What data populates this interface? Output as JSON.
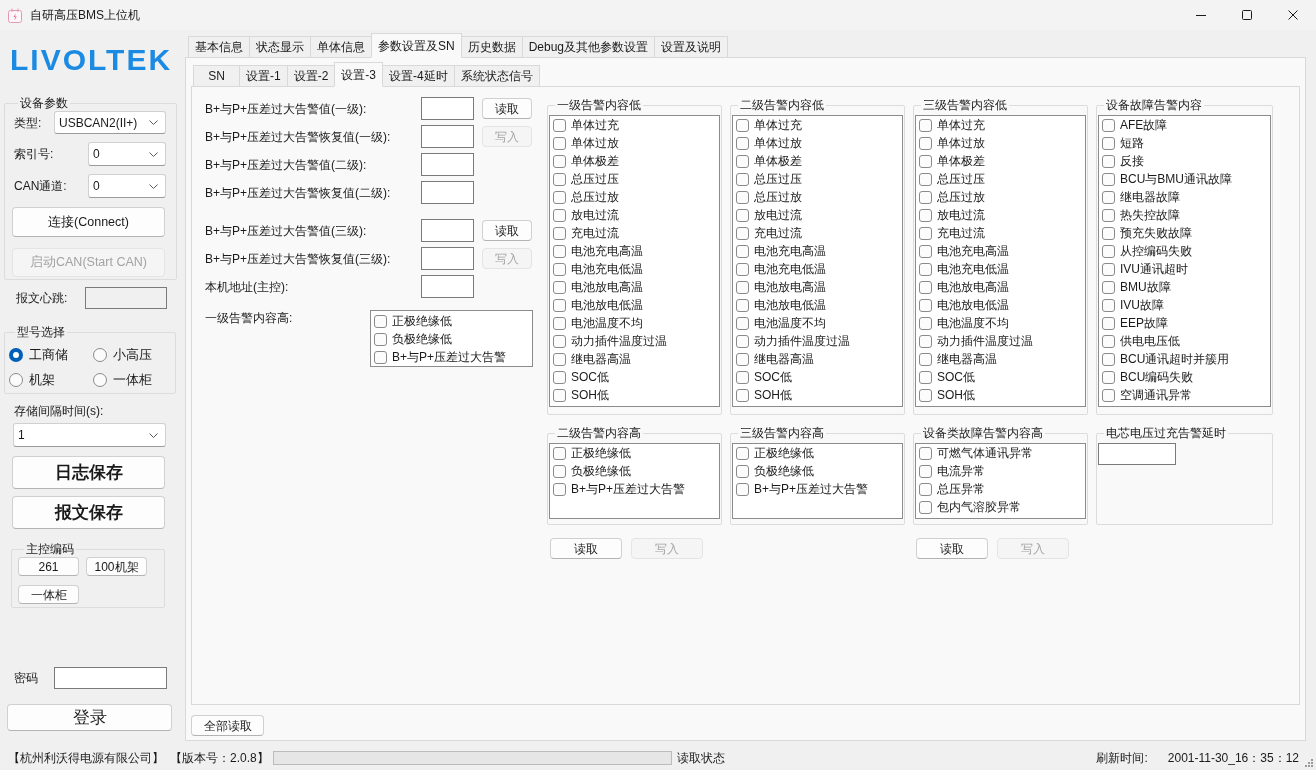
{
  "window": {
    "title": "自研高压BMS上位机"
  },
  "sidebar": {
    "logo": "LIVOLTEK",
    "device_params": {
      "title": "设备参数",
      "selects": [
        {
          "label": "类型:",
          "value": "USBCAN2(II+)"
        },
        {
          "label": "索引号:",
          "value": "0"
        },
        {
          "label": "CAN通道:",
          "value": "0"
        }
      ],
      "buttons": [
        {
          "label": "连接(Connect)",
          "disabled": false
        },
        {
          "label": "启动CAN(Start CAN)",
          "disabled": true
        }
      ]
    },
    "heartbeat": {
      "label": "报文心跳:"
    },
    "model_select": {
      "title": "型号选择",
      "options": [
        {
          "label": "工商储",
          "selected": true
        },
        {
          "label": "小高压",
          "selected": false
        },
        {
          "label": "机架",
          "selected": false
        },
        {
          "label": "一体柜",
          "selected": false
        }
      ]
    },
    "storage_interval": {
      "label": "存储间隔时间(s):",
      "value": "1"
    },
    "save_buttons": [
      "日志保存",
      "报文保存"
    ],
    "master_code": {
      "title": "主控编码",
      "buttons": [
        "261",
        "100机架",
        "一体柜"
      ]
    },
    "password": {
      "label": "密码"
    },
    "login_button": "登录"
  },
  "tabs": [
    {
      "label": "基本信息",
      "selected": false
    },
    {
      "label": "状态显示",
      "selected": false
    },
    {
      "label": "单体信息",
      "selected": false
    },
    {
      "label": "参数设置及SN",
      "selected": true
    },
    {
      "label": "历史数据",
      "selected": false
    },
    {
      "label": "Debug及其他参数设置",
      "selected": false
    },
    {
      "label": "设置及说明",
      "selected": false
    }
  ],
  "sub_tabs": [
    {
      "label": "SN",
      "selected": false
    },
    {
      "label": "设置-1",
      "selected": false
    },
    {
      "label": "设置-2",
      "selected": false
    },
    {
      "label": "设置-3",
      "selected": true
    },
    {
      "label": "设置-4延时",
      "selected": false
    },
    {
      "label": "系统状态信号",
      "selected": false
    }
  ],
  "settings": {
    "field_groups": [
      [
        {
          "label": "B+与P+压差过大告警值(一级):",
          "button": {
            "label": "读取",
            "disabled": false
          }
        },
        {
          "label": "B+与P+压差过大告警恢复值(一级):",
          "button": {
            "label": "写入",
            "disabled": true
          }
        },
        {
          "label": "B+与P+压差过大告警值(二级):"
        },
        {
          "label": "B+与P+压差过大告警恢复值(二级):"
        }
      ],
      [
        {
          "label": "B+与P+压差过大告警值(三级):",
          "button": {
            "label": "读取",
            "disabled": false
          }
        },
        {
          "label": "B+与P+压差过大告警恢复值(三级):",
          "button": {
            "label": "写入",
            "disabled": true
          }
        },
        {
          "label": "本机地址(主控):"
        }
      ]
    ],
    "level1_high": {
      "label": "一级告警内容高:",
      "items": [
        {
          "label": "正极绝缘低",
          "checked": false
        },
        {
          "label": "负极绝缘低",
          "checked": false
        },
        {
          "label": "B+与P+压差过大告警",
          "checked": false
        }
      ]
    },
    "alarm_groups": [
      {
        "kind": "checklist",
        "title": "一级告警内容低",
        "items": [
          {
            "label": "单体过充",
            "checked": false
          },
          {
            "label": "单体过放",
            "checked": false
          },
          {
            "label": "单体极差",
            "checked": false
          },
          {
            "label": "总压过压",
            "checked": false
          },
          {
            "label": "总压过放",
            "checked": false
          },
          {
            "label": "放电过流",
            "checked": false
          },
          {
            "label": "充电过流",
            "checked": false
          },
          {
            "label": "电池充电高温",
            "checked": false
          },
          {
            "label": "电池充电低温",
            "checked": false
          },
          {
            "label": "电池放电高温",
            "checked": false
          },
          {
            "label": "电池放电低温",
            "checked": false
          },
          {
            "label": "电池温度不均",
            "checked": false
          },
          {
            "label": "动力插件温度过温",
            "checked": false
          },
          {
            "label": "继电器高温",
            "checked": false
          },
          {
            "label": "SOC低",
            "checked": false
          },
          {
            "label": "SOH低",
            "checked": false
          }
        ]
      },
      {
        "kind": "checklist",
        "title": "二级告警内容低",
        "items": [
          {
            "label": "单体过充",
            "checked": false
          },
          {
            "label": "单体过放",
            "checked": false
          },
          {
            "label": "单体极差",
            "checked": false
          },
          {
            "label": "总压过压",
            "checked": false
          },
          {
            "label": "总压过放",
            "checked": false
          },
          {
            "label": "放电过流",
            "checked": false
          },
          {
            "label": "充电过流",
            "checked": false
          },
          {
            "label": "电池充电高温",
            "checked": false
          },
          {
            "label": "电池充电低温",
            "checked": false
          },
          {
            "label": "电池放电高温",
            "checked": false
          },
          {
            "label": "电池放电低温",
            "checked": false
          },
          {
            "label": "电池温度不均",
            "checked": false
          },
          {
            "label": "动力插件温度过温",
            "checked": false
          },
          {
            "label": "继电器高温",
            "checked": false
          },
          {
            "label": "SOC低",
            "checked": false
          },
          {
            "label": "SOH低",
            "checked": false
          }
        ]
      },
      {
        "kind": "checklist",
        "title": "三级告警内容低",
        "items": [
          {
            "label": "单体过充",
            "checked": false
          },
          {
            "label": "单体过放",
            "checked": false
          },
          {
            "label": "单体极差",
            "checked": false
          },
          {
            "label": "总压过压",
            "checked": false
          },
          {
            "label": "总压过放",
            "checked": false
          },
          {
            "label": "放电过流",
            "checked": false
          },
          {
            "label": "充电过流",
            "checked": false
          },
          {
            "label": "电池充电高温",
            "checked": false
          },
          {
            "label": "电池充电低温",
            "checked": false
          },
          {
            "label": "电池放电高温",
            "checked": false
          },
          {
            "label": "电池放电低温",
            "checked": false
          },
          {
            "label": "电池温度不均",
            "checked": false
          },
          {
            "label": "动力插件温度过温",
            "checked": false
          },
          {
            "label": "继电器高温",
            "checked": false
          },
          {
            "label": "SOC低",
            "checked": false
          },
          {
            "label": "SOH低",
            "checked": false
          }
        ]
      },
      {
        "kind": "checklist",
        "title": "设备故障告警内容",
        "items": [
          {
            "label": "AFE故障",
            "checked": false
          },
          {
            "label": "短路",
            "checked": false
          },
          {
            "label": "反接",
            "checked": false
          },
          {
            "label": "BCU与BMU通讯故障",
            "checked": false
          },
          {
            "label": "继电器故障",
            "checked": false
          },
          {
            "label": "热失控故障",
            "checked": false
          },
          {
            "label": "预充失败故障",
            "checked": false
          },
          {
            "label": "从控编码失败",
            "checked": false
          },
          {
            "label": "IVU通讯超时",
            "checked": false
          },
          {
            "label": "BMU故障",
            "checked": false
          },
          {
            "label": "IVU故障",
            "checked": false
          },
          {
            "label": "EEP故障",
            "checked": false
          },
          {
            "label": "供电电压低",
            "checked": false
          },
          {
            "label": "BCU通讯超时并簇用",
            "checked": false
          },
          {
            "label": "BCU编码失败",
            "checked": false
          },
          {
            "label": "空调通讯异常",
            "checked": false
          }
        ]
      },
      {
        "kind": "checklist",
        "title": "二级告警内容高",
        "items": [
          {
            "label": "正极绝缘低",
            "checked": false
          },
          {
            "label": "负极绝缘低",
            "checked": false
          },
          {
            "label": "B+与P+压差过大告警",
            "checked": false
          }
        ]
      },
      {
        "kind": "checklist",
        "title": "三级告警内容高",
        "items": [
          {
            "label": "正极绝缘低",
            "checked": false
          },
          {
            "label": "负极绝缘低",
            "checked": false
          },
          {
            "label": "B+与P+压差过大告警",
            "checked": false
          }
        ]
      },
      {
        "kind": "checklist",
        "title": "设备类故障告警内容高",
        "items": [
          {
            "label": "可燃气体通讯异常",
            "checked": false
          },
          {
            "label": "电流异常",
            "checked": false
          },
          {
            "label": "总压异常",
            "checked": false
          },
          {
            "label": "包内气溶胶异常",
            "checked": false
          }
        ]
      },
      {
        "kind": "input",
        "title": "电芯电压过充告警延时"
      }
    ],
    "button_sets": [
      [
        {
          "label": "读取",
          "disabled": false
        },
        {
          "label": "写入",
          "disabled": true
        }
      ],
      [
        {
          "label": "读取",
          "disabled": false
        },
        {
          "label": "写入",
          "disabled": true
        }
      ]
    ]
  },
  "read_all_button": "全部读取",
  "status_bar": {
    "company": "【杭州利沃得电源有限公司】",
    "version": "【版本号：2.0.8】",
    "progress": {
      "level": 0
    },
    "read_status": "读取状态",
    "refresh_label": "刷新时间:",
    "refresh_time": "2001-11-30_16：35：12"
  }
}
